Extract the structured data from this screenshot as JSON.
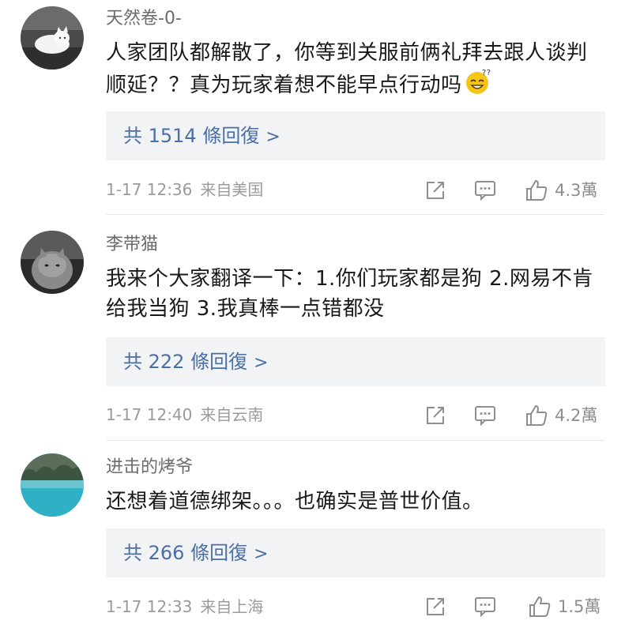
{
  "colors": {
    "link": "#4a6fa5",
    "meta": "#9a9a9a",
    "reply_bg": "#f2f3f5"
  },
  "comments": [
    {
      "username": "天然卷-0-",
      "text": "人家团队都解散了，你等到关服前俩礼拜去跟人谈判顺延？？真为玩家着想不能早点行动吗",
      "emoji_icon": "sweat-smile-icon",
      "replies_label": "共 1514 條回復",
      "arrow": ">",
      "time": "1-17 12:36",
      "source": "来自美国",
      "likes": "4.3萬",
      "avatar_icon": "white-cat-avatar"
    },
    {
      "username": "李带猫",
      "text": "我来个大家翻译一下：1.你们玩家都是狗 2.网易不肯给我当狗 3.我真棒一点错都没",
      "replies_label": "共 222 條回復",
      "arrow": ">",
      "time": "1-17 12:40",
      "source": "来自云南",
      "likes": "4.2萬",
      "avatar_icon": "grey-cat-avatar"
    },
    {
      "username": "进击的烤爷",
      "text": "还想着道德绑架。。。也确实是普世价值。",
      "replies_label": "共 266 條回復",
      "arrow": ">",
      "time": "1-17 12:33",
      "source": "来自上海",
      "likes": "1.5萬",
      "avatar_icon": "lake-landscape-avatar"
    }
  ]
}
